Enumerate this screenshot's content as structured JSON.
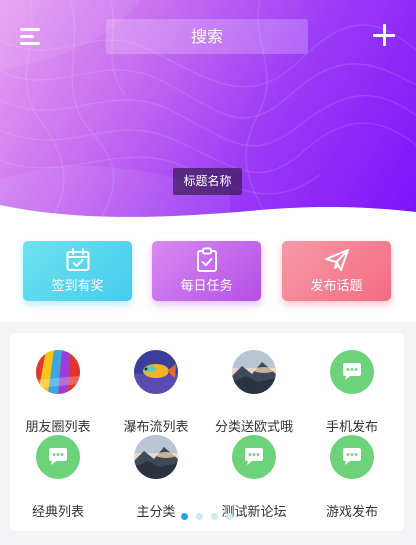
{
  "header": {
    "search_placeholder": "搜索",
    "title_tag": "标题名称",
    "gradient_colors": [
      "#e8a0f2",
      "#c56df0",
      "#9b3cf6",
      "#7d12fb"
    ]
  },
  "actions": [
    {
      "label": "签到有奖",
      "icon": "calendar-check-icon",
      "color": "#43ccec"
    },
    {
      "label": "每日任务",
      "icon": "clipboard-check-icon",
      "color": "#b34fe7"
    },
    {
      "label": "发布话题",
      "icon": "paper-plane-icon",
      "color": "#f46b82"
    }
  ],
  "grid": {
    "items": [
      {
        "label": "朋友圈列表",
        "icon": "hot-air-balloon-image"
      },
      {
        "label": "瀑布流列表",
        "icon": "fish-image"
      },
      {
        "label": "分类送欧式哦",
        "icon": "mountain-sunset-image"
      },
      {
        "label": "手机发布",
        "icon": "chat-bubble-icon"
      },
      {
        "label": "经典列表",
        "icon": "chat-bubble-icon"
      },
      {
        "label": "主分类",
        "icon": "mountain-sunset-image"
      },
      {
        "label": "测试新论坛",
        "icon": "chat-bubble-icon"
      },
      {
        "label": "游戏发布",
        "icon": "chat-bubble-icon"
      }
    ],
    "page_count": 4,
    "active_page": 1,
    "chat_icon_color": "#6cd37b"
  }
}
